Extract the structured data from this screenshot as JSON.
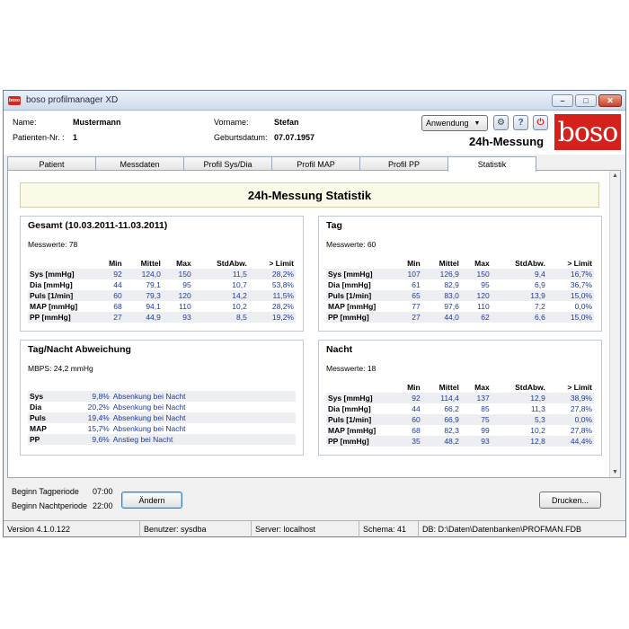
{
  "window": {
    "app_icon_text": "boso",
    "title": "boso profilmanager XD"
  },
  "header": {
    "name_label": "Name:",
    "name_value": "Mustermann",
    "pid_label": "Patienten-Nr. :",
    "pid_value": "1",
    "vorname_label": "Vorname:",
    "vorname_value": "Stefan",
    "geb_label": "Geburtsdatum:",
    "geb_value": "07.07.1957",
    "anwendung_label": "Anwendung",
    "mode_title": "24h-Messung",
    "logo_text": "boso"
  },
  "tabs": [
    {
      "label": "Patient"
    },
    {
      "label": "Messdaten"
    },
    {
      "label": "Profil Sys/Dia"
    },
    {
      "label": "Profil MAP"
    },
    {
      "label": "Profil PP"
    },
    {
      "label": "Statistik"
    }
  ],
  "active_tab": "Statistik",
  "stat_title": "24h-Messung Statistik",
  "columns": [
    "Min",
    "Mittel",
    "Max",
    "StdAbw.",
    "> Limit"
  ],
  "gesamt": {
    "title": "Gesamt (10.03.2011-11.03.2011)",
    "info": "Messwerte: 78",
    "rows": [
      [
        "Sys [mmHg]",
        "92",
        "124,0",
        "150",
        "11,5",
        "28,2%"
      ],
      [
        "Dia [mmHg]",
        "44",
        "79,1",
        "95",
        "10,7",
        "53,8%"
      ],
      [
        "Puls [1/min]",
        "60",
        "79,3",
        "120",
        "14,2",
        "11,5%"
      ],
      [
        "MAP [mmHg]",
        "68",
        "94,1",
        "110",
        "10,2",
        "28,2%"
      ],
      [
        "PP [mmHg]",
        "27",
        "44,9",
        "93",
        "8,5",
        "19,2%"
      ]
    ]
  },
  "tag": {
    "title": "Tag",
    "info": "Messwerte: 60",
    "rows": [
      [
        "Sys [mmHg]",
        "107",
        "126,9",
        "150",
        "9,4",
        "16,7%"
      ],
      [
        "Dia [mmHg]",
        "61",
        "82,9",
        "95",
        "6,9",
        "36,7%"
      ],
      [
        "Puls [1/min]",
        "65",
        "83,0",
        "120",
        "13,9",
        "15,0%"
      ],
      [
        "MAP [mmHg]",
        "77",
        "97,6",
        "110",
        "7,2",
        "0,0%"
      ],
      [
        "PP [mmHg]",
        "27",
        "44,0",
        "62",
        "6,6",
        "15,0%"
      ]
    ]
  },
  "abweichung": {
    "title": "Tag/Nacht Abweichung",
    "info": "MBPS: 24,2 mmHg",
    "rows": [
      [
        "Sys",
        "9,8%",
        "Absenkung bei Nacht"
      ],
      [
        "Dia",
        "20,2%",
        "Absenkung bei Nacht"
      ],
      [
        "Puls",
        "19,4%",
        "Absenkung bei Nacht"
      ],
      [
        "MAP",
        "15,7%",
        "Absenkung bei Nacht"
      ],
      [
        "PP",
        "9,6%",
        "Anstieg bei Nacht"
      ]
    ]
  },
  "nacht": {
    "title": "Nacht",
    "info": "Messwerte: 18",
    "rows": [
      [
        "Sys [mmHg]",
        "92",
        "114,4",
        "137",
        "12,9",
        "38,9%"
      ],
      [
        "Dia [mmHg]",
        "44",
        "66,2",
        "85",
        "11,3",
        "27,8%"
      ],
      [
        "Puls [1/min]",
        "60",
        "66,9",
        "75",
        "5,3",
        "0,0%"
      ],
      [
        "MAP [mmHg]",
        "68",
        "82,3",
        "99",
        "10,2",
        "27,8%"
      ],
      [
        "PP [mmHg]",
        "35",
        "48,2",
        "93",
        "12,8",
        "44,4%"
      ]
    ]
  },
  "periods": {
    "tag_label": "Beginn Tagperiode",
    "tag_time": "07:00",
    "nacht_label": "Beginn Nachtperiode",
    "nacht_time": "22:00",
    "aendern_label": "Ändern",
    "drucken_label": "Drucken..."
  },
  "statusbar": {
    "version": "Version 4.1.0.122",
    "user": "Benutzer: sysdba",
    "server": "Server: localhost",
    "schema": "Schema: 41",
    "db": "DB: D:\\Daten\\Datenbanken\\PROFMAN.FDB"
  }
}
